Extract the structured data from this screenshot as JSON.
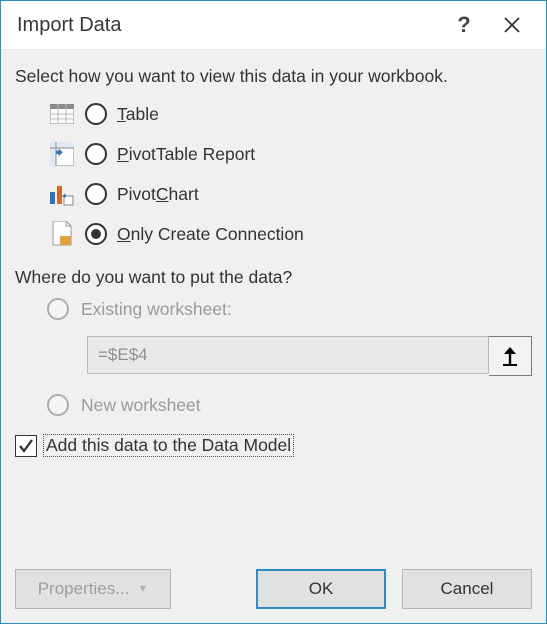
{
  "title": "Import Data",
  "helpTooltip": "Help",
  "closeTooltip": "Close",
  "viewLabel": "Select how you want to view this data in your workbook.",
  "options": {
    "table": {
      "pre": "",
      "u": "T",
      "post": "able",
      "selected": false
    },
    "pivot": {
      "pre": "",
      "u": "P",
      "post": "ivotTable Report",
      "selected": false
    },
    "chart": {
      "pre": "Pivot",
      "u": "C",
      "post": "hart",
      "selected": false
    },
    "conn": {
      "pre": "",
      "u": "O",
      "post": "nly Create Connection",
      "selected": true
    }
  },
  "putLabel": "Where do you want to put the data?",
  "put": {
    "existing": "Existing worksheet:",
    "ref": "=$E$4",
    "new": "New worksheet"
  },
  "check": {
    "checked": true,
    "pre": "Add this data to the Data ",
    "u": "M",
    "post": "odel"
  },
  "buttons": {
    "props": "Properties...",
    "ok": "OK",
    "cancel": "Cancel"
  }
}
